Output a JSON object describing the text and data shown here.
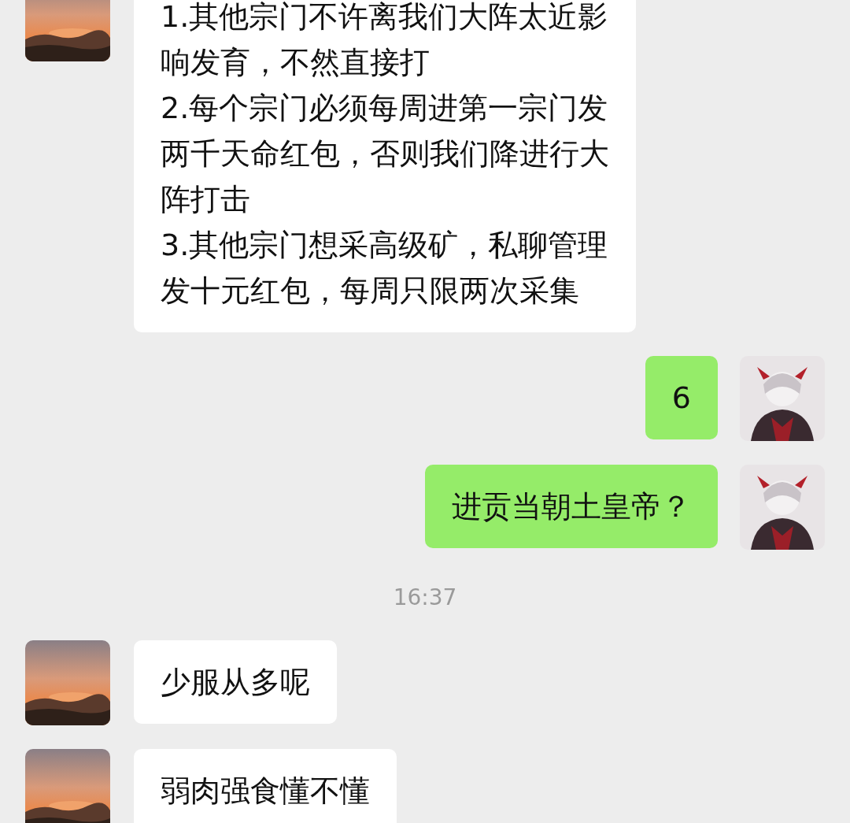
{
  "messages": [
    {
      "kind": "incoming",
      "lines": [
        "1.其他宗门不许离我们大阵太近影",
        "响发育，不然直接打",
        "2.每个宗门必须每周进第一宗门发",
        "两千天命红包，否则我们降进行大",
        "阵打击",
        "3.其他宗门想采高级矿，私聊管理",
        "发十元红包，每周只限两次采集"
      ]
    },
    {
      "kind": "outgoing",
      "lines": [
        "6"
      ]
    },
    {
      "kind": "outgoing",
      "lines": [
        "进贡当朝土皇帝？"
      ]
    },
    {
      "kind": "time",
      "text": "16:37"
    },
    {
      "kind": "incoming",
      "lines": [
        "少服从多呢"
      ]
    },
    {
      "kind": "incoming",
      "lines": [
        "弱肉强食懂不懂"
      ]
    }
  ]
}
